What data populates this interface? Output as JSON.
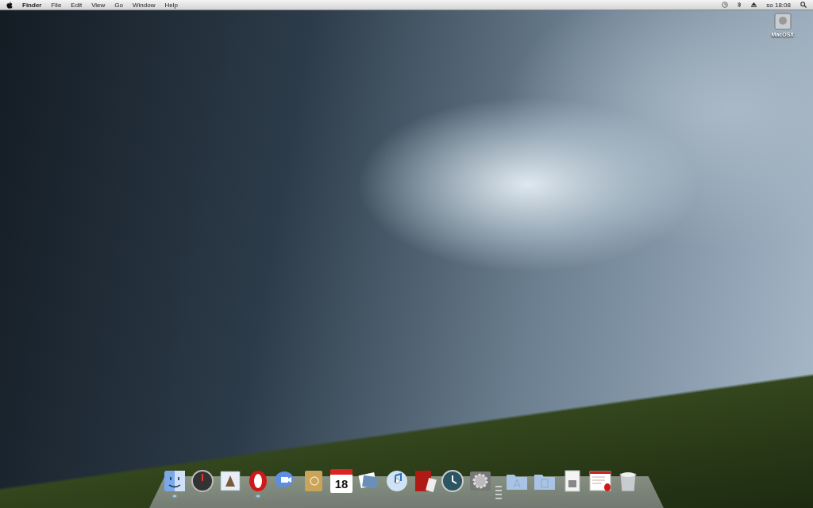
{
  "menu_bar": {
    "app_name": "Finder",
    "menus": [
      "File",
      "Edit",
      "View",
      "Go",
      "Window",
      "Help"
    ],
    "clock": "so 18:08"
  },
  "desktop_icons": [
    {
      "label": "MacOSX",
      "kind": "drive"
    }
  ],
  "dock": {
    "items": [
      {
        "kind": "finder",
        "running": true
      },
      {
        "kind": "dashboard",
        "running": false
      },
      {
        "kind": "mail",
        "running": false
      },
      {
        "kind": "opera",
        "running": true
      },
      {
        "kind": "chat",
        "running": false
      },
      {
        "kind": "addressbook",
        "running": false
      },
      {
        "kind": "calendar",
        "running": false,
        "text": "18"
      },
      {
        "kind": "photos",
        "running": false
      },
      {
        "kind": "music",
        "running": false
      },
      {
        "kind": "photobooth",
        "running": false
      },
      {
        "kind": "timemachine",
        "running": false
      },
      {
        "kind": "preferences",
        "running": false
      },
      {
        "kind": "separator"
      },
      {
        "kind": "apps-folder",
        "running": false
      },
      {
        "kind": "docs-folder",
        "running": false
      },
      {
        "kind": "downloads",
        "running": false
      },
      {
        "kind": "webstack",
        "running": false
      },
      {
        "kind": "trash",
        "running": false
      }
    ]
  }
}
